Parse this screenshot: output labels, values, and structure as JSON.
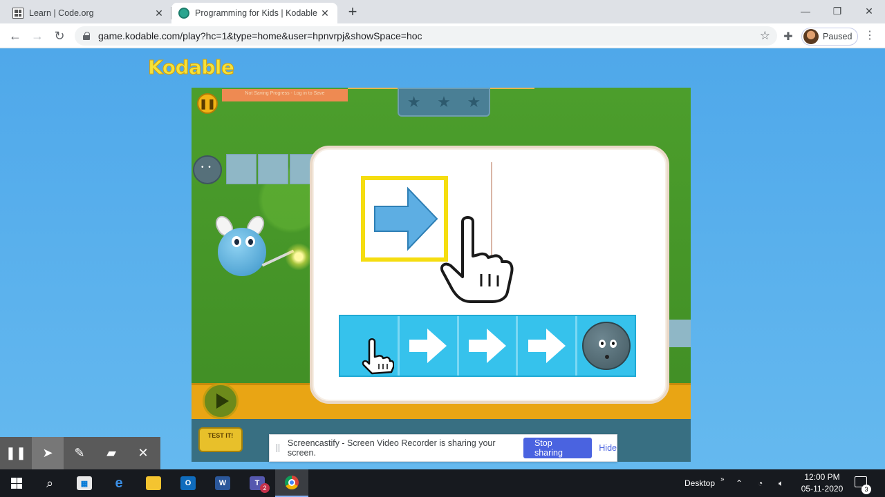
{
  "browser": {
    "tabs": [
      {
        "title": "Learn | Code.org",
        "active": false
      },
      {
        "title": "Programming for Kids | Kodable",
        "active": true
      }
    ],
    "url": "game.kodable.com/play?hc=1&type=home&user=hpnvrpj&showSpace=hoc",
    "profile_status": "Paused"
  },
  "page": {
    "logo": "Kodable",
    "game": {
      "notice": "Not Saving Progress - Log in to Save",
      "stars_earned": 0,
      "stars_total": 3,
      "test_button": "TEST IT!",
      "tutorial": {
        "target_command": "arrow-right",
        "code_sequence": [
          "empty",
          "arrow-right",
          "arrow-right",
          "arrow-right",
          "fuzz"
        ]
      }
    }
  },
  "screencastify": {
    "message": "Screencastify - Screen Video Recorder is sharing your screen.",
    "stop_label": "Stop sharing",
    "hide_label": "Hide"
  },
  "taskbar": {
    "desktop_label": "Desktop",
    "time": "12:00 PM",
    "date": "05-11-2020",
    "notification_count": "3",
    "teams_badge": "2"
  },
  "colors": {
    "page_bg": "#5aaee8",
    "accent_blue": "#4a63e0",
    "code_row": "#36c2ec",
    "target_border": "#f5dd10"
  }
}
